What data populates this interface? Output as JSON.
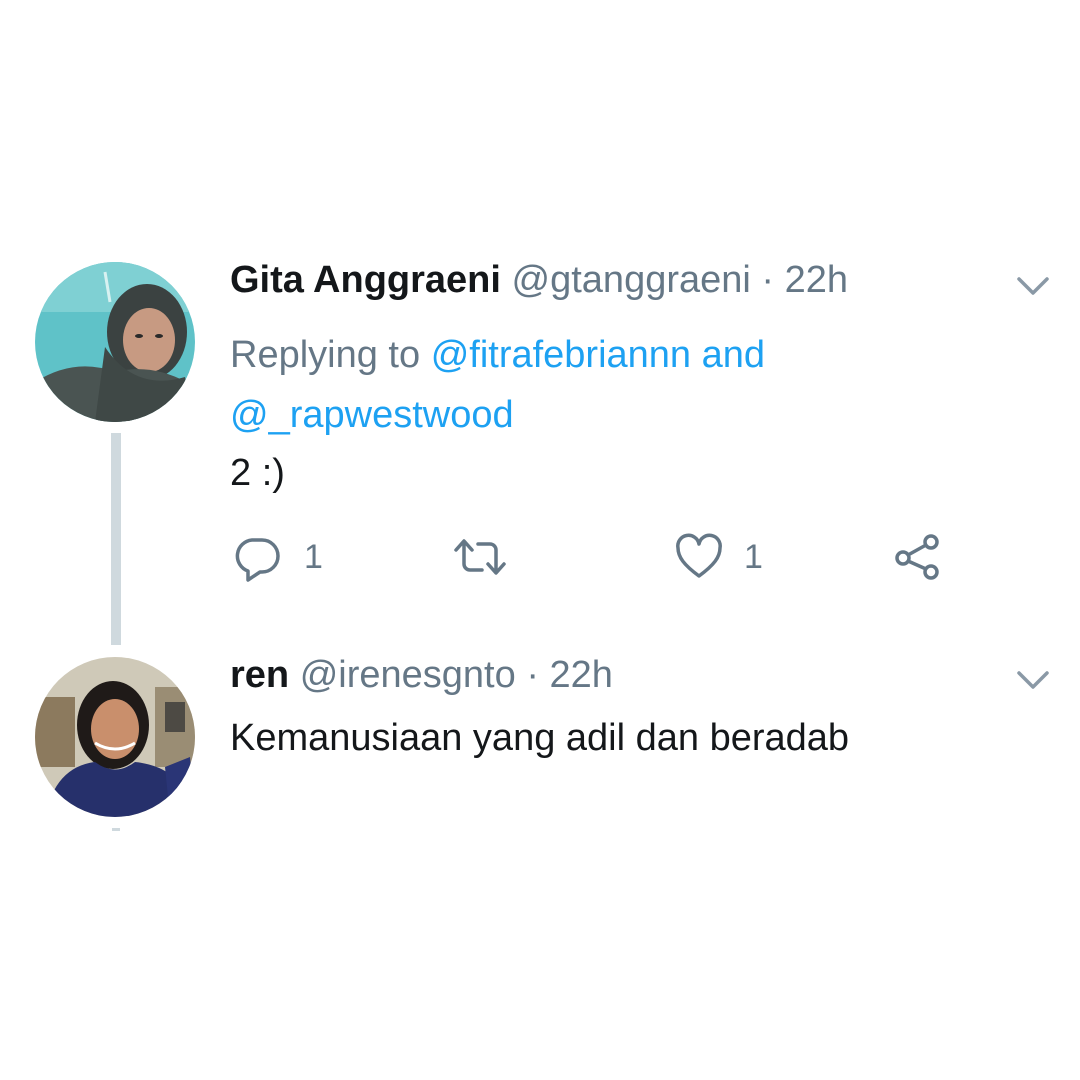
{
  "tweets": [
    {
      "author_name": "Gita Anggraeni",
      "handle": "@gtanggraeni",
      "separator": "·",
      "time": "22h",
      "replying_prefix": "Replying to",
      "replying_mention_1": "@fitrafebriannn",
      "replying_and": "and",
      "replying_mention_2": "@_rapwestwood",
      "text": "2 :)",
      "actions": {
        "reply_icon": "reply-bubble-icon",
        "reply_count": "1",
        "retweet_icon": "retweet-icon",
        "like_icon": "heart-icon",
        "like_count": "1",
        "share_icon": "share-icon"
      }
    },
    {
      "author_name": "ren",
      "handle": "@irenesgnto",
      "separator": "·",
      "time": "22h",
      "text": "Kemanusiaan yang adil dan beradab"
    }
  ],
  "colors": {
    "text_primary": "#14171a",
    "text_secondary": "#657786",
    "link": "#1da1f2",
    "thread_line": "#cfd9de",
    "background": "#ffffff"
  }
}
